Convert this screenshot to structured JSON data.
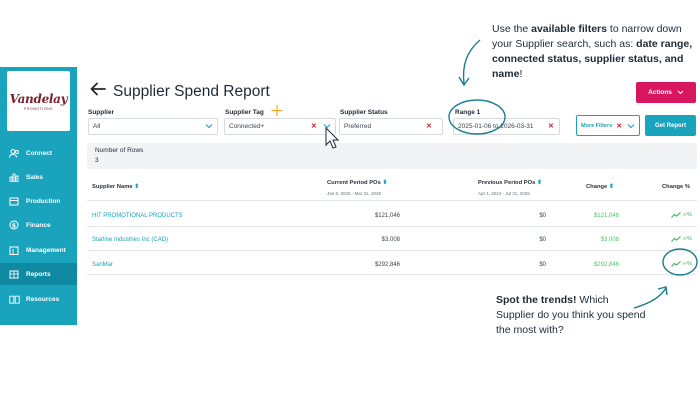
{
  "sidebar": {
    "logo_text": "Vandelay",
    "logo_sub": "PROMOTIONS",
    "items": [
      {
        "label": "Connect",
        "icon": "users-icon"
      },
      {
        "label": "Sales",
        "icon": "bar-chart-icon"
      },
      {
        "label": "Production",
        "icon": "box-icon"
      },
      {
        "label": "Finance",
        "icon": "dollar-icon"
      },
      {
        "label": "Management",
        "icon": "building-icon"
      },
      {
        "label": "Reports",
        "icon": "table-icon"
      },
      {
        "label": "Resources",
        "icon": "book-icon"
      }
    ],
    "active": "Reports"
  },
  "header": {
    "title": "Supplier Spend Report",
    "actions_label": "Actions"
  },
  "filters": {
    "supplier": {
      "label": "Supplier",
      "value": "All"
    },
    "tag": {
      "label": "Supplier Tag",
      "value": "Connected+"
    },
    "status": {
      "label": "Supplier Status",
      "value": "Preferred"
    },
    "range": {
      "label": "Range 1",
      "value": "2025-01-06 to 2026-03-31"
    },
    "more_filters_label": "More Filters",
    "get_report_label": "Get Report"
  },
  "rows_info": {
    "label": "Number of Rows",
    "count": "3"
  },
  "table": {
    "headers": {
      "name": "Supplier Name",
      "current": "Current Period POs",
      "current_sub": "Jan 6, 2025 - Mar 31, 2026",
      "previous": "Previous Period POs",
      "previous_sub": "Apr 1, 2024 - Jul 31, 2026",
      "change": "Change",
      "change_pct": "Change %"
    },
    "rows": [
      {
        "name": "Starline Industries Inc (CAD)",
        "current": "$3,008",
        "previous": "$0",
        "change": "$3,008",
        "pct": "∞%"
      },
      {
        "name": "SanMar",
        "current": "$292,846",
        "previous": "$0",
        "change": "$292,846",
        "pct": "∞%"
      },
      {
        "name": "HIT PROMOTIONAL PRODUCTS",
        "current": "$121,046",
        "previous": "$0",
        "change": "$121,046",
        "pct": "∞%"
      }
    ]
  },
  "annotations": {
    "top_1": "Use the ",
    "top_bold_1": "available filters",
    "top_2": " to narrow down your Supplier search, such as: ",
    "top_bold_2": "date range, connected status, supplier status, and name",
    "top_3": "!",
    "bottom_bold": "Spot the trends!",
    "bottom_text": " Which Supplier do you think you spend the most with?"
  },
  "colors": {
    "accent": "#1aa3bc",
    "actions": "#d8155f",
    "positive": "#4fc46d",
    "clear_x": "#d31c2c"
  }
}
